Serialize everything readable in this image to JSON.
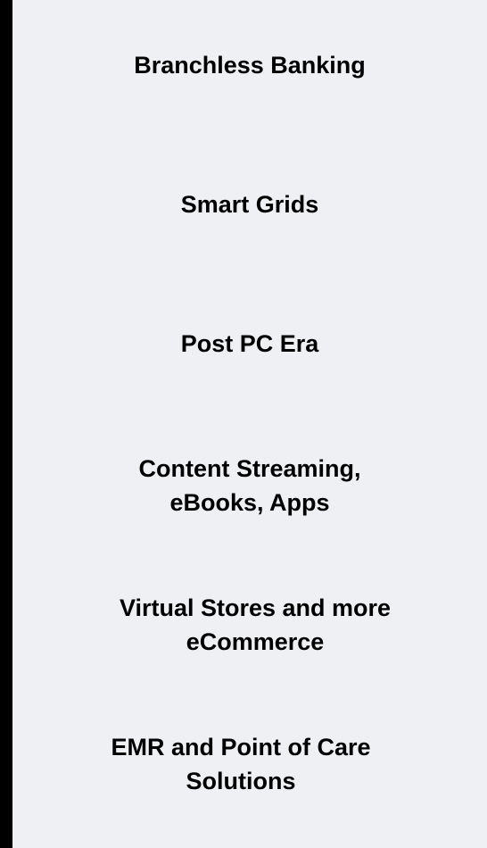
{
  "items": [
    {
      "lines": [
        "Branchless Banking"
      ]
    },
    {
      "lines": [
        "Smart Grids"
      ]
    },
    {
      "lines": [
        "Post PC Era"
      ]
    },
    {
      "lines": [
        "Content Streaming,",
        "eBooks, Apps"
      ]
    },
    {
      "lines": [
        "Virtual Stores and more",
        "eCommerce"
      ]
    },
    {
      "lines": [
        "EMR and Point of Care",
        "Solutions"
      ]
    }
  ],
  "colors": {
    "border": "#000000",
    "panel_background": "#eef0f4",
    "text": "#000000"
  }
}
